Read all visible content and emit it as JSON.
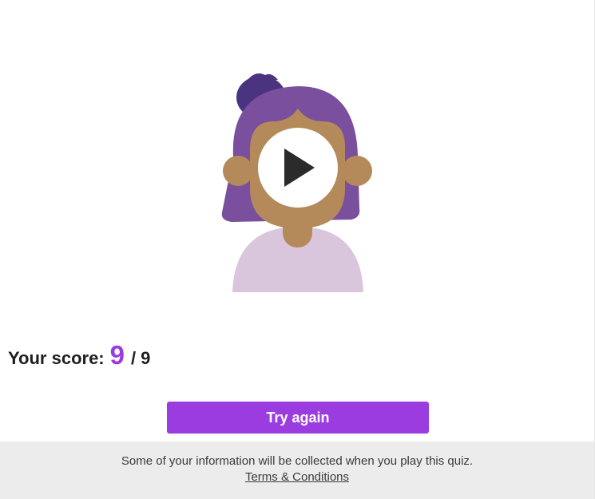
{
  "result": {
    "score_label": "Your score:",
    "score_value": "9",
    "score_separator": "/",
    "score_total": "9"
  },
  "actions": {
    "try_again_label": "Try again"
  },
  "footer": {
    "notice": "Some of your information will be collected when you play this quiz.",
    "terms_link": "Terms & Conditions"
  },
  "media": {
    "avatar_icon": "girl-avatar-illustration",
    "play_icon": "play-icon"
  },
  "colors": {
    "accent": "#9b3ce0",
    "hair": "#7a4f9e",
    "hair_bun": "#4a347f",
    "skin": "#b58a5b",
    "shirt": "#d9c5dc",
    "footer_bg": "#ececec",
    "text": "#1f1f1f"
  }
}
